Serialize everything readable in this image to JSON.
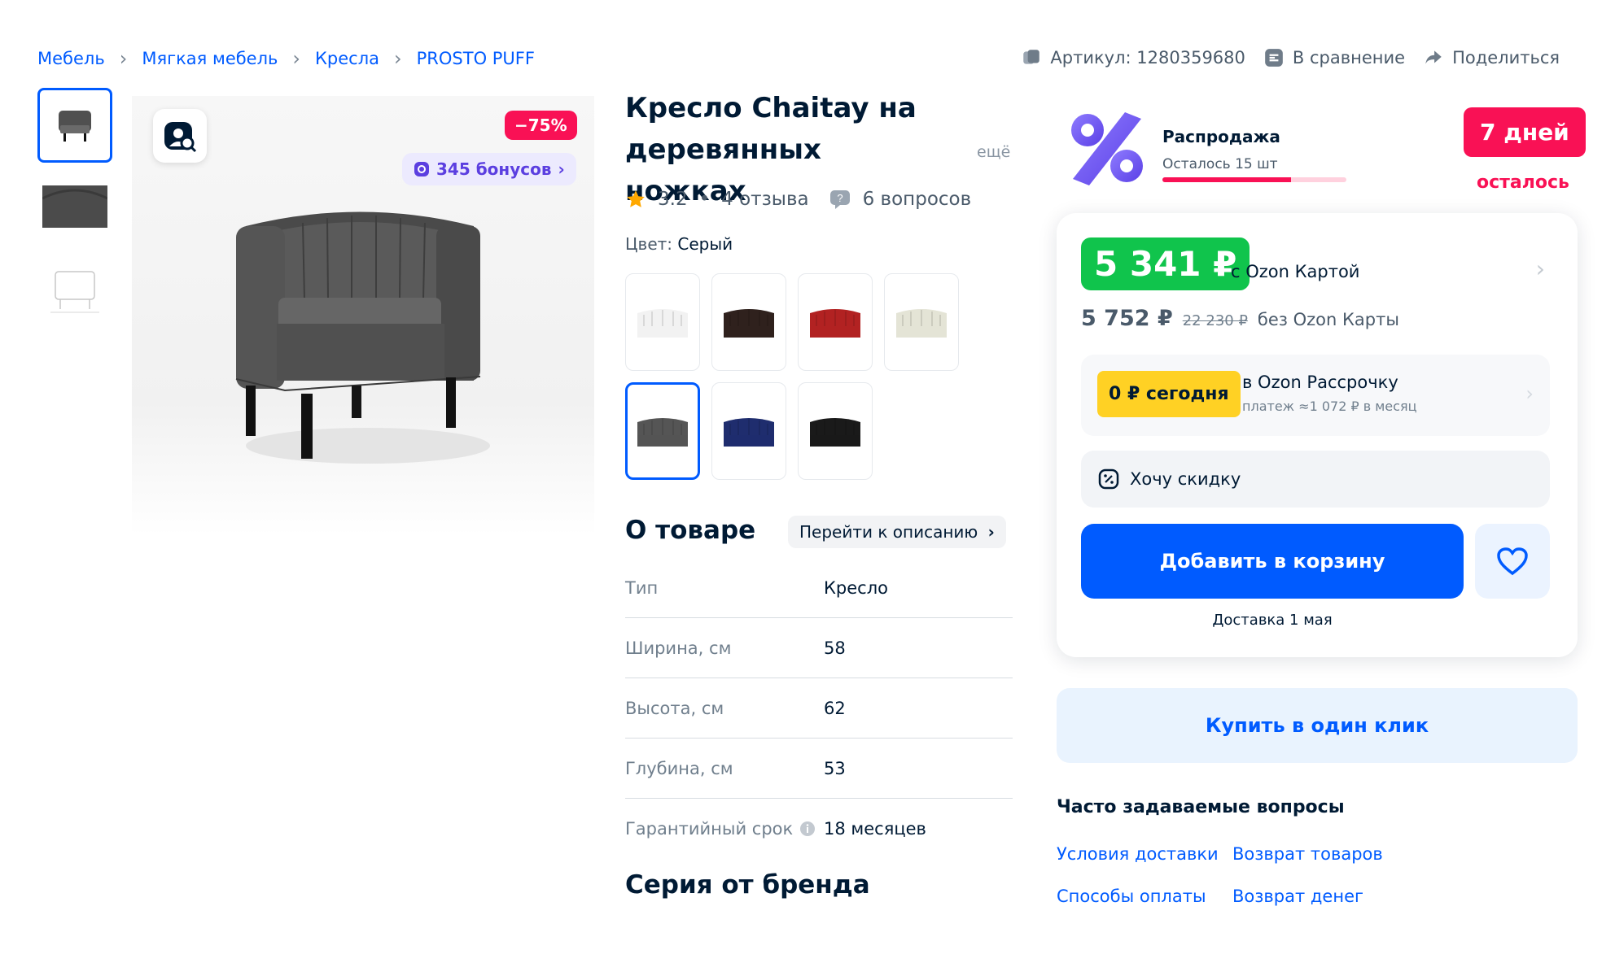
{
  "breadcrumbs": [
    "Мебель",
    "Мягкая мебель",
    "Кресла",
    "PROSTO PUFF"
  ],
  "top_actions": {
    "sku": "Артикул: 1280359680",
    "compare": "В сравнение",
    "share": "Поделиться"
  },
  "gallery": {
    "discount": "−75%",
    "bonus": "345 бонусов",
    "bonus_chevron": "›"
  },
  "product": {
    "title": "Кресло Chaitay на деревянных ножках",
    "more": "ещё",
    "rating": "3.2",
    "reviews": "4 отзыва",
    "bullet": "•",
    "questions": "6 вопросов",
    "color_label": "Цвет:",
    "color_value": "Серый",
    "swatch_colors": [
      "#f2f2f2",
      "#2f211d",
      "#b22222",
      "#e4e4d6",
      "#555555",
      "#1f2d6e",
      "#1a1a1a"
    ],
    "selected_swatch": 4
  },
  "about": {
    "title": "О товаре",
    "go_to_desc": "Перейти к описанию",
    "specs": [
      {
        "key": "Тип",
        "value": "Кресло"
      },
      {
        "key": "Ширина, см",
        "value": "58"
      },
      {
        "key": "Высота, см",
        "value": "62"
      },
      {
        "key": "Глубина, см",
        "value": "53"
      },
      {
        "key": "Гарантийный срок",
        "value": "18 месяцев"
      }
    ],
    "series_title": "Серия от бренда"
  },
  "sale": {
    "title": "Распродажа",
    "left": "Осталось 15 шт",
    "progress": 0.7,
    "days": "7 дней",
    "days_label": "осталось"
  },
  "price": {
    "card_price": "5 341 ₽",
    "card_label": "с Ozon Картой",
    "price_no_card": "5 752 ₽",
    "old_price": "22 230 ₽",
    "no_card_label": "без Ozon Карты",
    "installment_badge": "0 ₽ сегодня",
    "installment_title": "в Ozon Рассрочку",
    "installment_sub": "платеж ≈1 072 ₽ в месяц",
    "want_discount": "Хочу скидку",
    "add_to_cart": "Добавить в корзину",
    "delivery": "Доставка 1 мая",
    "buy_one_click": "Купить в один клик",
    "chevron": "›"
  },
  "faq": {
    "title": "Часто задаваемые вопросы",
    "links": [
      "Условия доставки",
      "Возврат товаров",
      "Способы оплаты",
      "Возврат денег"
    ]
  },
  "colors": {
    "accent": "#005bff",
    "sale": "#f91155",
    "price_green": "#10c44c",
    "installment_yellow": "#ffd124"
  }
}
